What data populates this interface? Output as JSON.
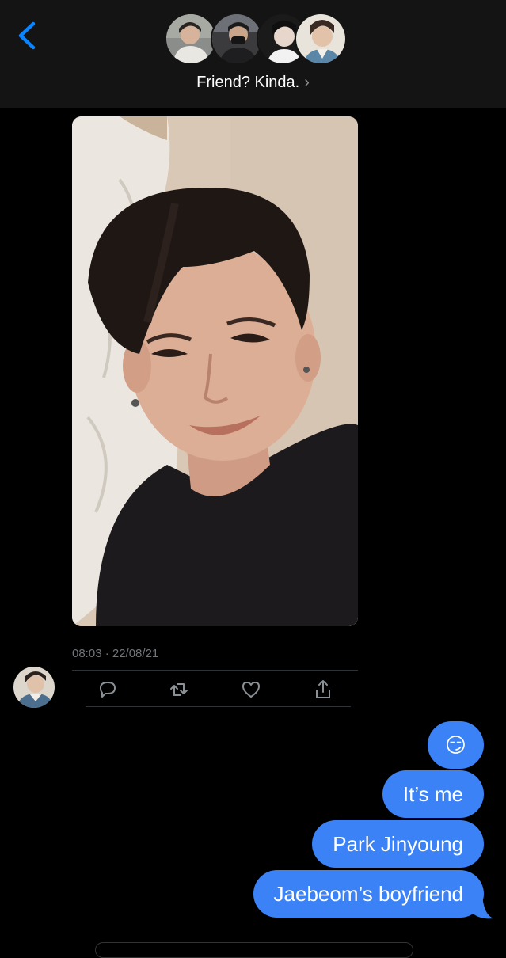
{
  "header": {
    "title": "Friend? Kinda.",
    "avatars": [
      "group-avatar-1",
      "group-avatar-2",
      "group-avatar-3",
      "group-avatar-4"
    ],
    "accent_color": "#0a84ff"
  },
  "tweet": {
    "timestamp": "08:03 · 22/08/21",
    "actions": [
      "reply-icon",
      "retweet-icon",
      "like-icon",
      "share-icon"
    ]
  },
  "messages": [
    {
      "text": "😏"
    },
    {
      "text": "It’s me"
    },
    {
      "text": "Park Jinyoung"
    },
    {
      "text": "Jaebeom’s boyfriend"
    }
  ],
  "bubble_color": "#3a82f6"
}
